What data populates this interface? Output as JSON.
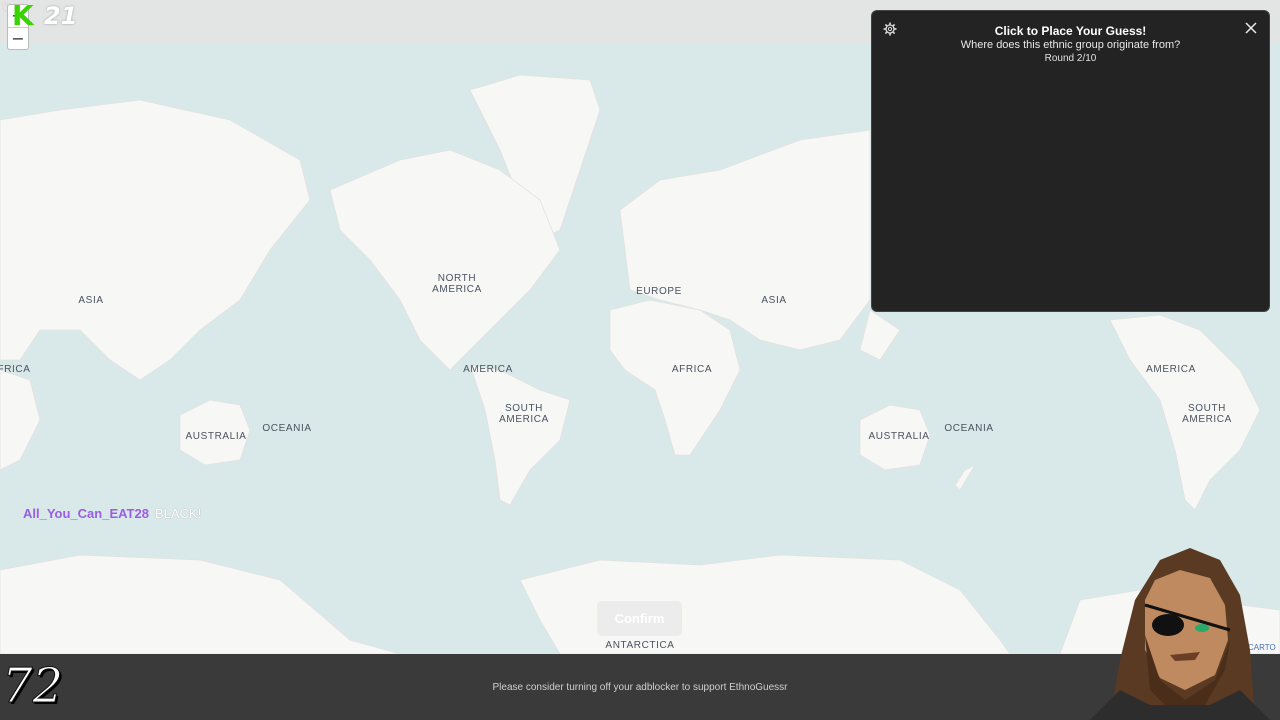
{
  "header": {
    "logo_letter": "K",
    "stream_score": "21",
    "zoom_in": "+",
    "zoom_out": "−"
  },
  "map": {
    "labels": {
      "asia_left": "ASIA",
      "africa_left": "FRICA",
      "australia_left": "AUSTRALIA",
      "oceania_left": "OCEANIA",
      "north_america": "NORTH\nAMERICA",
      "america_mid": "AMERICA",
      "south_america_mid": "SOUTH\nAMERICA",
      "europe": "EUROPE",
      "asia_mid": "ASIA",
      "africa_mid": "AFRICA",
      "australia_right": "AUSTRALIA",
      "oceania_right": "OCEANIA",
      "america_right": "AMERICA",
      "south_america_right": "SOUTH\nAMERICA",
      "antarctica": "ANTARCTICA"
    },
    "attribution": "CARTO"
  },
  "panel": {
    "title": "Click to Place Your Guess!",
    "question": "Where does this ethnic group originate from?",
    "round": "Round 2/10",
    "settings_icon": "gear-icon",
    "close_icon": "close-icon"
  },
  "chat": {
    "username": "All_You_Can_EAT28",
    "message": "BLACK!"
  },
  "confirm_label": "Confirm",
  "footer": {
    "notice": "Please consider turning off your adblocker to support EthnoGuessr",
    "badge": "72"
  },
  "colors": {
    "ocean": "#d9e8e9",
    "land": "#f7f7f5",
    "panel_bg": "#232323",
    "chat_user": "#9b5de5",
    "footer_bg": "#3a3a3a"
  }
}
